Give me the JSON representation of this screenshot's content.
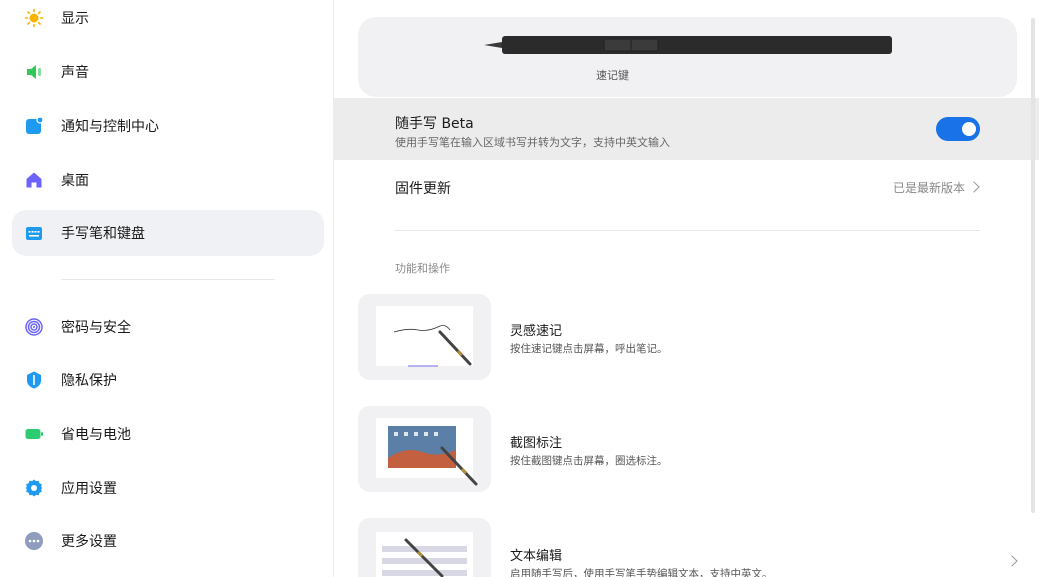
{
  "sidebar": {
    "items": [
      {
        "label": "显示",
        "icon": "sun-icon",
        "color": "#f7b500"
      },
      {
        "label": "声音",
        "icon": "speaker-icon",
        "color": "#34c759"
      },
      {
        "label": "通知与控制中心",
        "icon": "notification-icon",
        "color": "#1e9bf0"
      },
      {
        "label": "桌面",
        "icon": "home-icon",
        "color": "#6c63ff"
      },
      {
        "label": "手写笔和键盘",
        "icon": "keyboard-icon",
        "color": "#1e9bf0"
      },
      {
        "label": "密码与安全",
        "icon": "fingerprint-icon",
        "color": "#6c63ff"
      },
      {
        "label": "隐私保护",
        "icon": "shield-icon",
        "color": "#1e9bf0"
      },
      {
        "label": "省电与电池",
        "icon": "battery-icon",
        "color": "#2ecc71"
      },
      {
        "label": "应用设置",
        "icon": "gear-icon",
        "color": "#1e9bf0"
      },
      {
        "label": "更多设置",
        "icon": "more-icon",
        "color": "#8e9cc0"
      }
    ]
  },
  "main": {
    "pen_caption": "速记键",
    "handwriting": {
      "title": "随手写 Beta",
      "subtitle": "使用手写笔在输入区域书写并转为文字，支持中英文输入",
      "toggle": "on"
    },
    "firmware": {
      "title": "固件更新",
      "value": "已是最新版本"
    },
    "section_label": "功能和操作",
    "features": [
      {
        "title": "灵感速记",
        "desc": "按住速记键点击屏幕，呼出笔记。"
      },
      {
        "title": "截图标注",
        "desc": "按住截图键点击屏幕，圈选标注。"
      },
      {
        "title": "文本编辑",
        "desc": "启用随手写后，使用手写笔手势编辑文本，支持中英文。"
      }
    ]
  },
  "colors": {
    "accent": "#1a72e8",
    "active_bg": "#f0f1f4"
  }
}
